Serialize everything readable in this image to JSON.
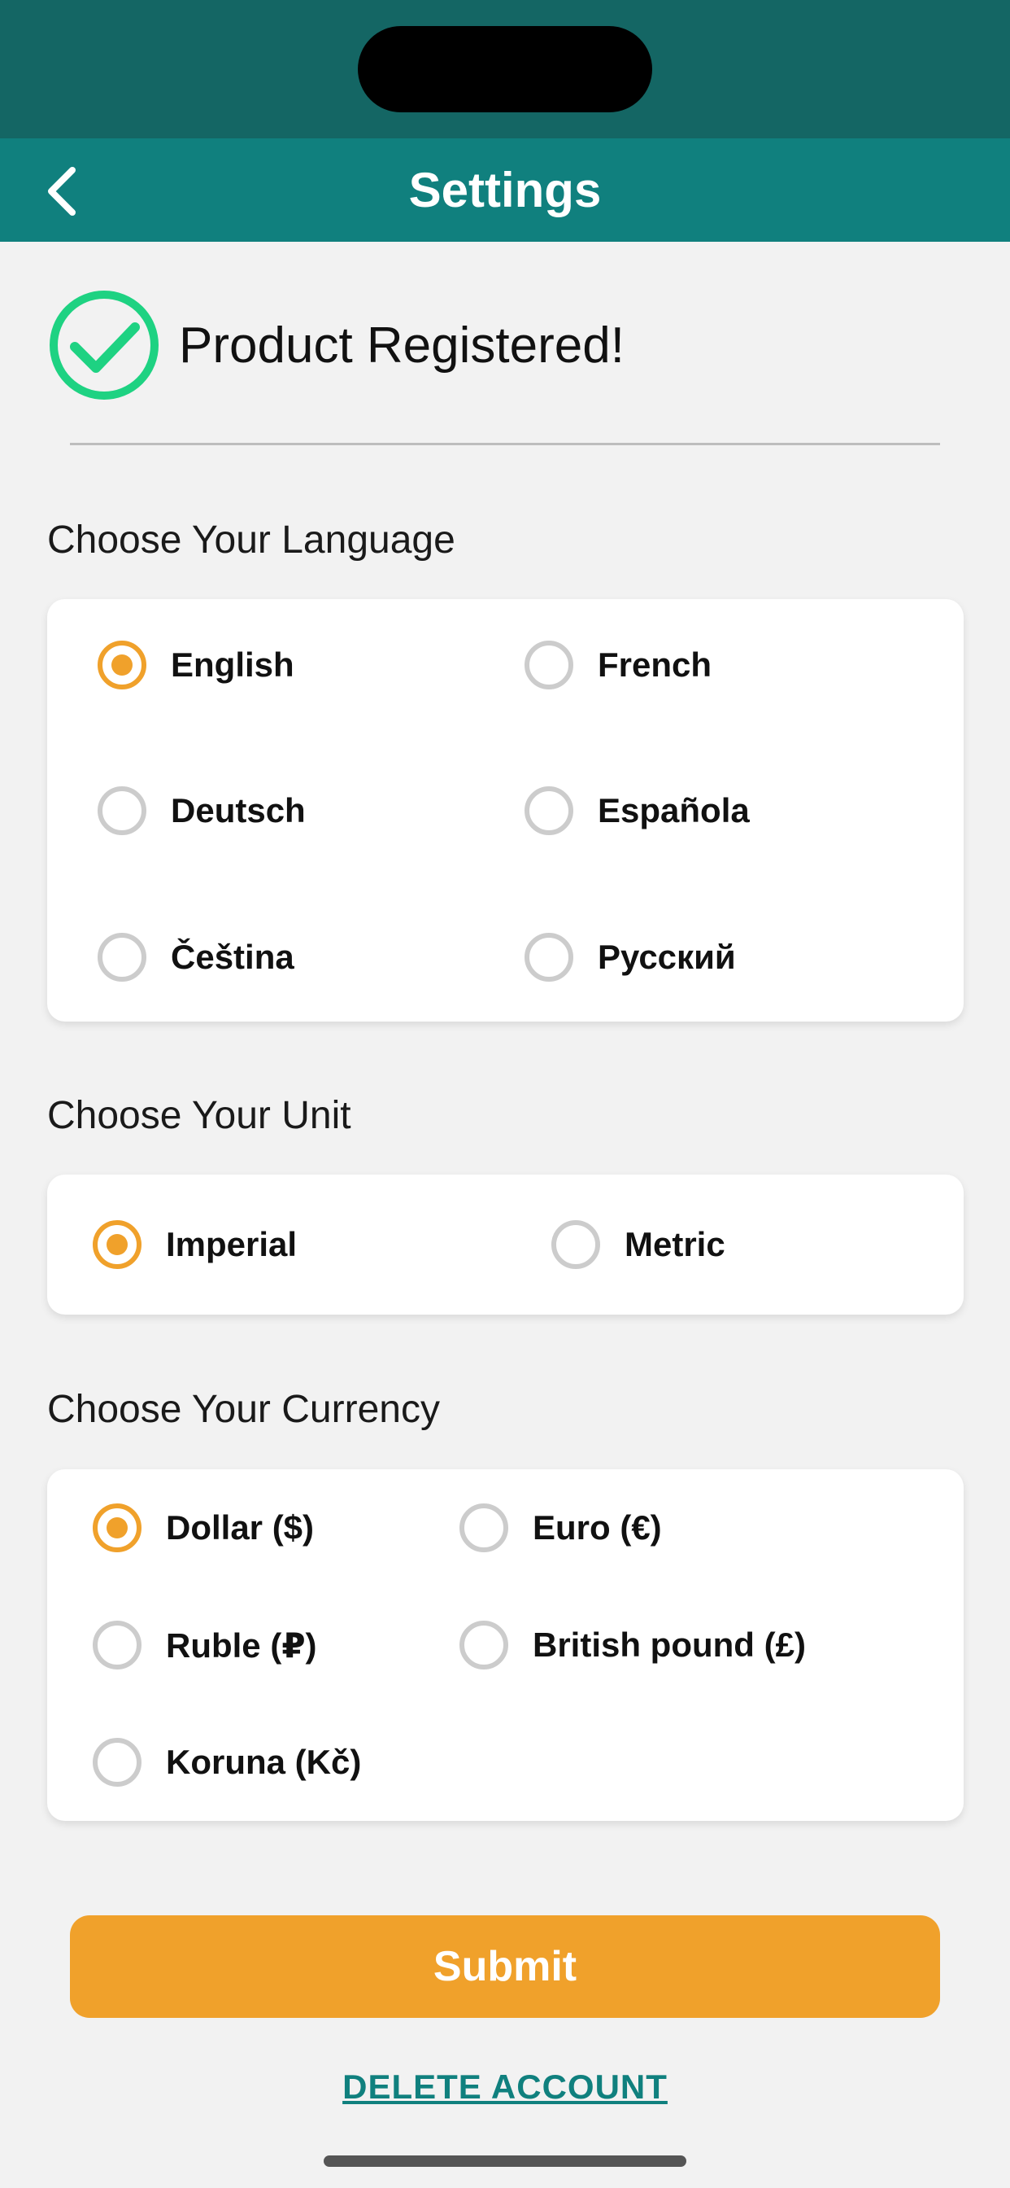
{
  "header": {
    "title": "Settings"
  },
  "registration": {
    "message": "Product Registered!"
  },
  "language": {
    "label": "Choose Your Language",
    "options": [
      {
        "label": "English",
        "selected": true
      },
      {
        "label": "French",
        "selected": false
      },
      {
        "label": "Deutsch",
        "selected": false
      },
      {
        "label": "Española",
        "selected": false
      },
      {
        "label": "Čeština",
        "selected": false
      },
      {
        "label": "Русский",
        "selected": false
      }
    ]
  },
  "unit": {
    "label": "Choose Your Unit",
    "options": [
      {
        "label": "Imperial",
        "selected": true
      },
      {
        "label": "Metric",
        "selected": false
      }
    ]
  },
  "currency": {
    "label": "Choose Your Currency",
    "options": [
      {
        "label": "Dollar ($)",
        "selected": true
      },
      {
        "label": "Euro (€)",
        "selected": false
      },
      {
        "label": "Ruble (₽)",
        "selected": false
      },
      {
        "label": "British pound (£)",
        "selected": false
      },
      {
        "label": "Koruna (Kč)",
        "selected": false
      }
    ]
  },
  "actions": {
    "submit_label": "Submit",
    "delete_label": "DELETE ACCOUNT"
  },
  "colors": {
    "header_bg": "#10807e",
    "status_bar_bg": "#146664",
    "accent": "#f0a12b",
    "success": "#1ed282",
    "link": "#10807e"
  }
}
